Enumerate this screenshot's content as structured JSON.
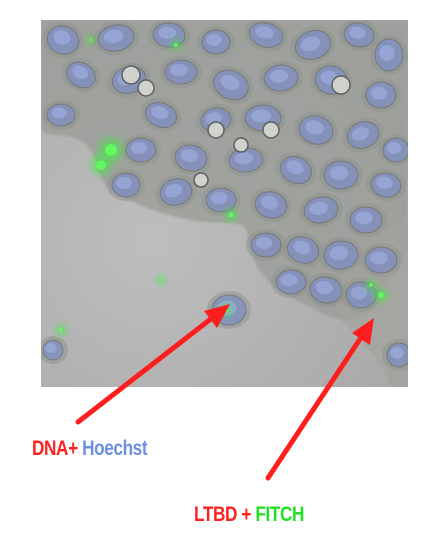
{
  "labels": {
    "dna": {
      "part1": "DNA+",
      "part2": "Hoechst"
    },
    "ltbd": {
      "part1": "LTBD",
      "part2": "+",
      "part3": "FITCH"
    }
  },
  "colors": {
    "red": "#ff2020",
    "blue": "#6d8fe0",
    "green": "#22e022",
    "arrow": "#ff1e1e",
    "background": "#b4b4b4"
  }
}
